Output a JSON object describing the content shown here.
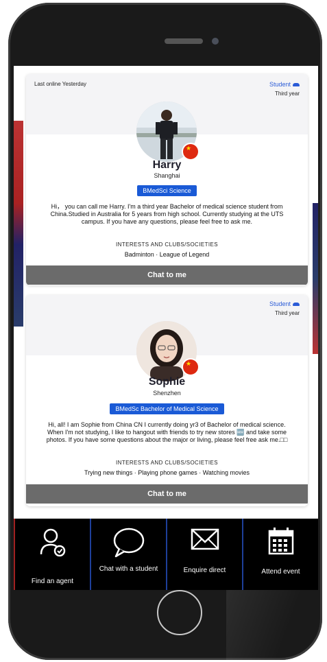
{
  "cards": [
    {
      "last_online": "Last online Yesterday",
      "role": "Student",
      "year": "Third year",
      "name": "Harry",
      "city": "Shanghai",
      "course": "BMedSci Science",
      "bio": "Hi， you can call me Harry. I'm a third year Bachelor of medical science student from China.Studied in Australia for 5 years from high school. Currently studying at the UTS campus. If you have any questions, please feel free to ask me.",
      "interests_title": "INTERESTS AND CLUBS/SOCIETIES",
      "interests": "Badminton · League of Legend",
      "chat_label": "Chat to me"
    },
    {
      "role": "Student",
      "year": "Third year",
      "name": "Sophie",
      "city": "Shenzhen",
      "course": "BMedSc Bachelor of Medical Science",
      "bio": "Hi, all! I am Sophie from China CN I currently doing yr3 of Bachelor of medical science. When I'm not studying, I like to hangout with friends to try new stores 🆕 and take some photos. If you have some questions about the major or living, please feel free ask me.□□",
      "interests_title": "INTERESTS AND CLUBS/SOCIETIES",
      "interests": "Trying new things · Playing phone games · Watching movies",
      "chat_label": "Chat to me"
    }
  ],
  "tabs": [
    {
      "label": "Find an agent",
      "icon": "find-agent-icon"
    },
    {
      "label": "Chat with a student",
      "icon": "chat-bubble-icon"
    },
    {
      "label": "Enquire direct",
      "icon": "envelope-icon"
    },
    {
      "label": "Attend event",
      "icon": "calendar-icon"
    }
  ],
  "colors": {
    "accent_blue": "#1a5ad6",
    "chat_button": "#6b6b6b",
    "flag_red": "#de2910"
  }
}
